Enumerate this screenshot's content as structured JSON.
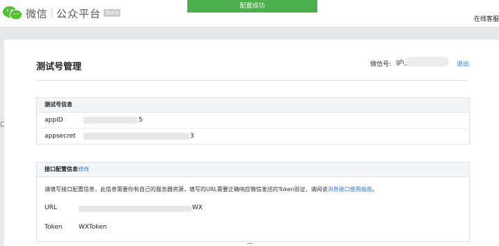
{
  "header": {
    "brand": "微信",
    "product": "公众平台",
    "beta": "Beta",
    "success_banner": "配置成功",
    "online_service": "在线客服"
  },
  "page": {
    "title": "测试号管理",
    "wechat_id_label": "微信号:",
    "wechat_id_value": "gh_",
    "logout_label": "退出"
  },
  "test_account": {
    "heading": "测试号信息",
    "rows": [
      {
        "label": "appID",
        "value_suffix": "5"
      },
      {
        "label": "appsecret",
        "value_suffix": "3"
      }
    ]
  },
  "interface_config": {
    "heading": "接口配置信息",
    "edit_link": "修改",
    "description_prefix": "请填写接口配置信息，此信息需要你有自己的服务器资源，填写的URL需要正确响应微信发送的Token验证，请阅读",
    "description_link": "消息接口使用指南",
    "description_suffix": "。",
    "url_label": "URL",
    "url_value_suffix": "WX",
    "token_label": "Token",
    "token_value": "WXToken"
  },
  "side": {
    "left_edge_text": "口"
  },
  "colors": {
    "success_green": "#4cae4c",
    "link_blue": "#2e7bd6",
    "panel_header_bg": "#f4f5f9",
    "page_bg": "#e7e8eb"
  }
}
